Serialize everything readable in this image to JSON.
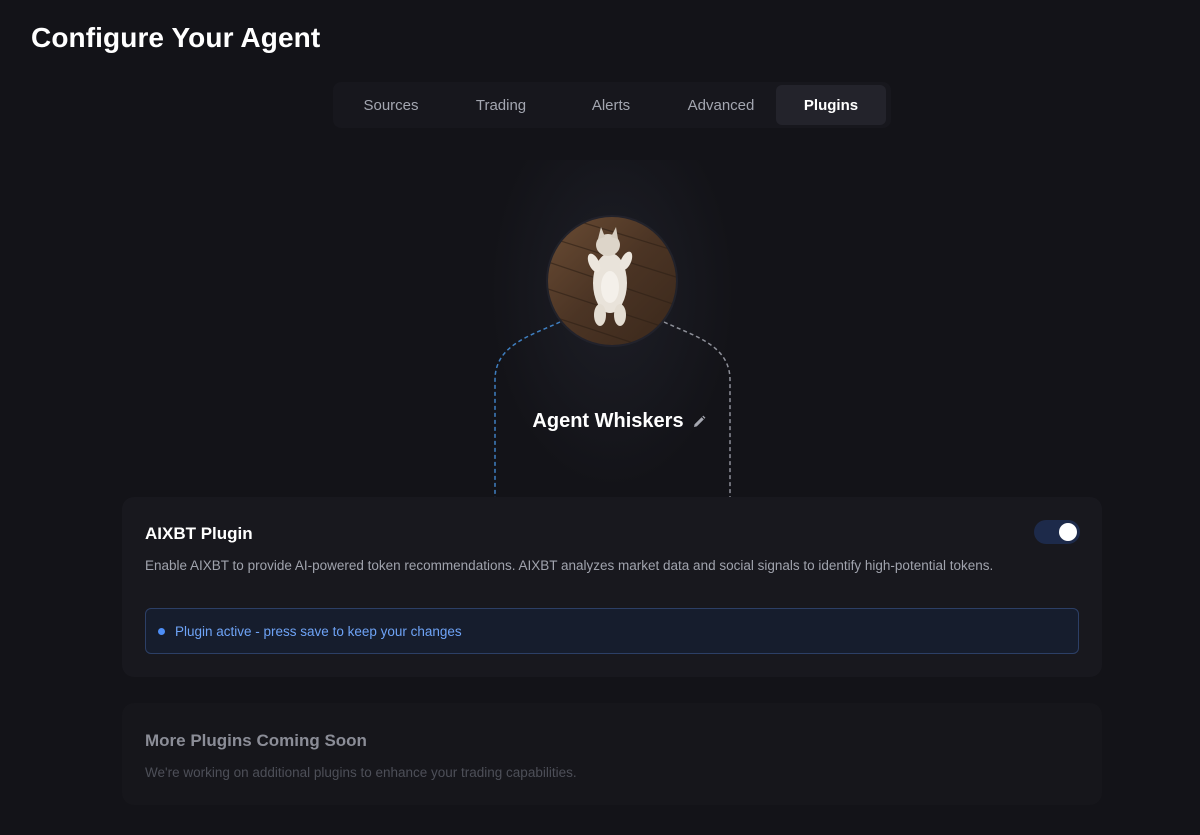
{
  "page": {
    "title": "Configure Your Agent"
  },
  "tabs": [
    {
      "label": "Sources",
      "active": false
    },
    {
      "label": "Trading",
      "active": false
    },
    {
      "label": "Alerts",
      "active": false
    },
    {
      "label": "Advanced",
      "active": false
    },
    {
      "label": "Plugins",
      "active": true
    }
  ],
  "agent": {
    "name": "Agent Whiskers",
    "avatar_icon": "cat-photo",
    "edit_icon": "pencil-icon"
  },
  "plugin": {
    "title": "AIXBT Plugin",
    "description": "Enable AIXBT to provide AI-powered token recommendations. AIXBT analyzes market data and social signals to identify high-potential tokens.",
    "enabled": true,
    "status_text": "Plugin active - press save to keep your changes"
  },
  "coming_soon": {
    "title": "More Plugins Coming Soon",
    "description": "We're working on additional plugins to enhance your trading capabilities."
  },
  "colors": {
    "background": "#131318",
    "accent": "#4d8ef7",
    "card": "#18181e"
  }
}
